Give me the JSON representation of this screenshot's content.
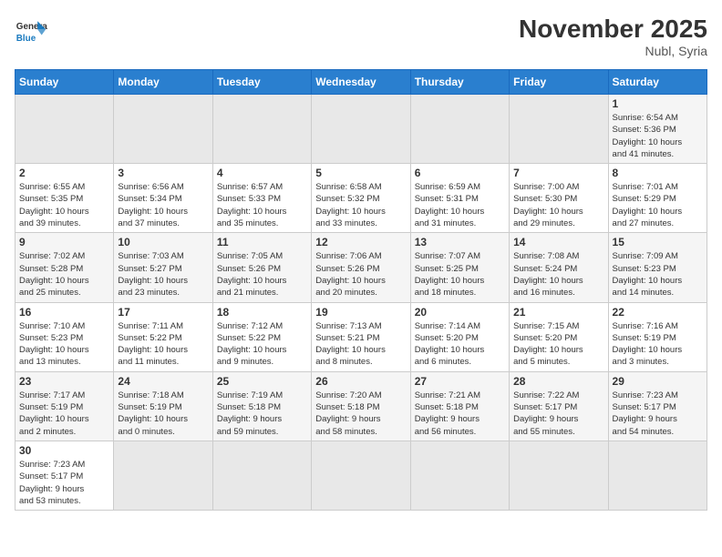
{
  "header": {
    "logo_general": "General",
    "logo_blue": "Blue",
    "month_year": "November 2025",
    "location": "Nubl, Syria"
  },
  "weekdays": [
    "Sunday",
    "Monday",
    "Tuesday",
    "Wednesday",
    "Thursday",
    "Friday",
    "Saturday"
  ],
  "weeks": [
    [
      {
        "day": "",
        "info": ""
      },
      {
        "day": "",
        "info": ""
      },
      {
        "day": "",
        "info": ""
      },
      {
        "day": "",
        "info": ""
      },
      {
        "day": "",
        "info": ""
      },
      {
        "day": "",
        "info": ""
      },
      {
        "day": "1",
        "info": "Sunrise: 6:54 AM\nSunset: 5:36 PM\nDaylight: 10 hours\nand 41 minutes."
      }
    ],
    [
      {
        "day": "2",
        "info": "Sunrise: 6:55 AM\nSunset: 5:35 PM\nDaylight: 10 hours\nand 39 minutes."
      },
      {
        "day": "3",
        "info": "Sunrise: 6:56 AM\nSunset: 5:34 PM\nDaylight: 10 hours\nand 37 minutes."
      },
      {
        "day": "4",
        "info": "Sunrise: 6:57 AM\nSunset: 5:33 PM\nDaylight: 10 hours\nand 35 minutes."
      },
      {
        "day": "5",
        "info": "Sunrise: 6:58 AM\nSunset: 5:32 PM\nDaylight: 10 hours\nand 33 minutes."
      },
      {
        "day": "6",
        "info": "Sunrise: 6:59 AM\nSunset: 5:31 PM\nDaylight: 10 hours\nand 31 minutes."
      },
      {
        "day": "7",
        "info": "Sunrise: 7:00 AM\nSunset: 5:30 PM\nDaylight: 10 hours\nand 29 minutes."
      },
      {
        "day": "8",
        "info": "Sunrise: 7:01 AM\nSunset: 5:29 PM\nDaylight: 10 hours\nand 27 minutes."
      }
    ],
    [
      {
        "day": "9",
        "info": "Sunrise: 7:02 AM\nSunset: 5:28 PM\nDaylight: 10 hours\nand 25 minutes."
      },
      {
        "day": "10",
        "info": "Sunrise: 7:03 AM\nSunset: 5:27 PM\nDaylight: 10 hours\nand 23 minutes."
      },
      {
        "day": "11",
        "info": "Sunrise: 7:05 AM\nSunset: 5:26 PM\nDaylight: 10 hours\nand 21 minutes."
      },
      {
        "day": "12",
        "info": "Sunrise: 7:06 AM\nSunset: 5:26 PM\nDaylight: 10 hours\nand 20 minutes."
      },
      {
        "day": "13",
        "info": "Sunrise: 7:07 AM\nSunset: 5:25 PM\nDaylight: 10 hours\nand 18 minutes."
      },
      {
        "day": "14",
        "info": "Sunrise: 7:08 AM\nSunset: 5:24 PM\nDaylight: 10 hours\nand 16 minutes."
      },
      {
        "day": "15",
        "info": "Sunrise: 7:09 AM\nSunset: 5:23 PM\nDaylight: 10 hours\nand 14 minutes."
      }
    ],
    [
      {
        "day": "16",
        "info": "Sunrise: 7:10 AM\nSunset: 5:23 PM\nDaylight: 10 hours\nand 13 minutes."
      },
      {
        "day": "17",
        "info": "Sunrise: 7:11 AM\nSunset: 5:22 PM\nDaylight: 10 hours\nand 11 minutes."
      },
      {
        "day": "18",
        "info": "Sunrise: 7:12 AM\nSunset: 5:22 PM\nDaylight: 10 hours\nand 9 minutes."
      },
      {
        "day": "19",
        "info": "Sunrise: 7:13 AM\nSunset: 5:21 PM\nDaylight: 10 hours\nand 8 minutes."
      },
      {
        "day": "20",
        "info": "Sunrise: 7:14 AM\nSunset: 5:20 PM\nDaylight: 10 hours\nand 6 minutes."
      },
      {
        "day": "21",
        "info": "Sunrise: 7:15 AM\nSunset: 5:20 PM\nDaylight: 10 hours\nand 5 minutes."
      },
      {
        "day": "22",
        "info": "Sunrise: 7:16 AM\nSunset: 5:19 PM\nDaylight: 10 hours\nand 3 minutes."
      }
    ],
    [
      {
        "day": "23",
        "info": "Sunrise: 7:17 AM\nSunset: 5:19 PM\nDaylight: 10 hours\nand 2 minutes."
      },
      {
        "day": "24",
        "info": "Sunrise: 7:18 AM\nSunset: 5:19 PM\nDaylight: 10 hours\nand 0 minutes."
      },
      {
        "day": "25",
        "info": "Sunrise: 7:19 AM\nSunset: 5:18 PM\nDaylight: 9 hours\nand 59 minutes."
      },
      {
        "day": "26",
        "info": "Sunrise: 7:20 AM\nSunset: 5:18 PM\nDaylight: 9 hours\nand 58 minutes."
      },
      {
        "day": "27",
        "info": "Sunrise: 7:21 AM\nSunset: 5:18 PM\nDaylight: 9 hours\nand 56 minutes."
      },
      {
        "day": "28",
        "info": "Sunrise: 7:22 AM\nSunset: 5:17 PM\nDaylight: 9 hours\nand 55 minutes."
      },
      {
        "day": "29",
        "info": "Sunrise: 7:23 AM\nSunset: 5:17 PM\nDaylight: 9 hours\nand 54 minutes."
      }
    ],
    [
      {
        "day": "30",
        "info": "Sunrise: 7:23 AM\nSunset: 5:17 PM\nDaylight: 9 hours\nand 53 minutes."
      },
      {
        "day": "",
        "info": ""
      },
      {
        "day": "",
        "info": ""
      },
      {
        "day": "",
        "info": ""
      },
      {
        "day": "",
        "info": ""
      },
      {
        "day": "",
        "info": ""
      },
      {
        "day": "",
        "info": ""
      }
    ]
  ]
}
